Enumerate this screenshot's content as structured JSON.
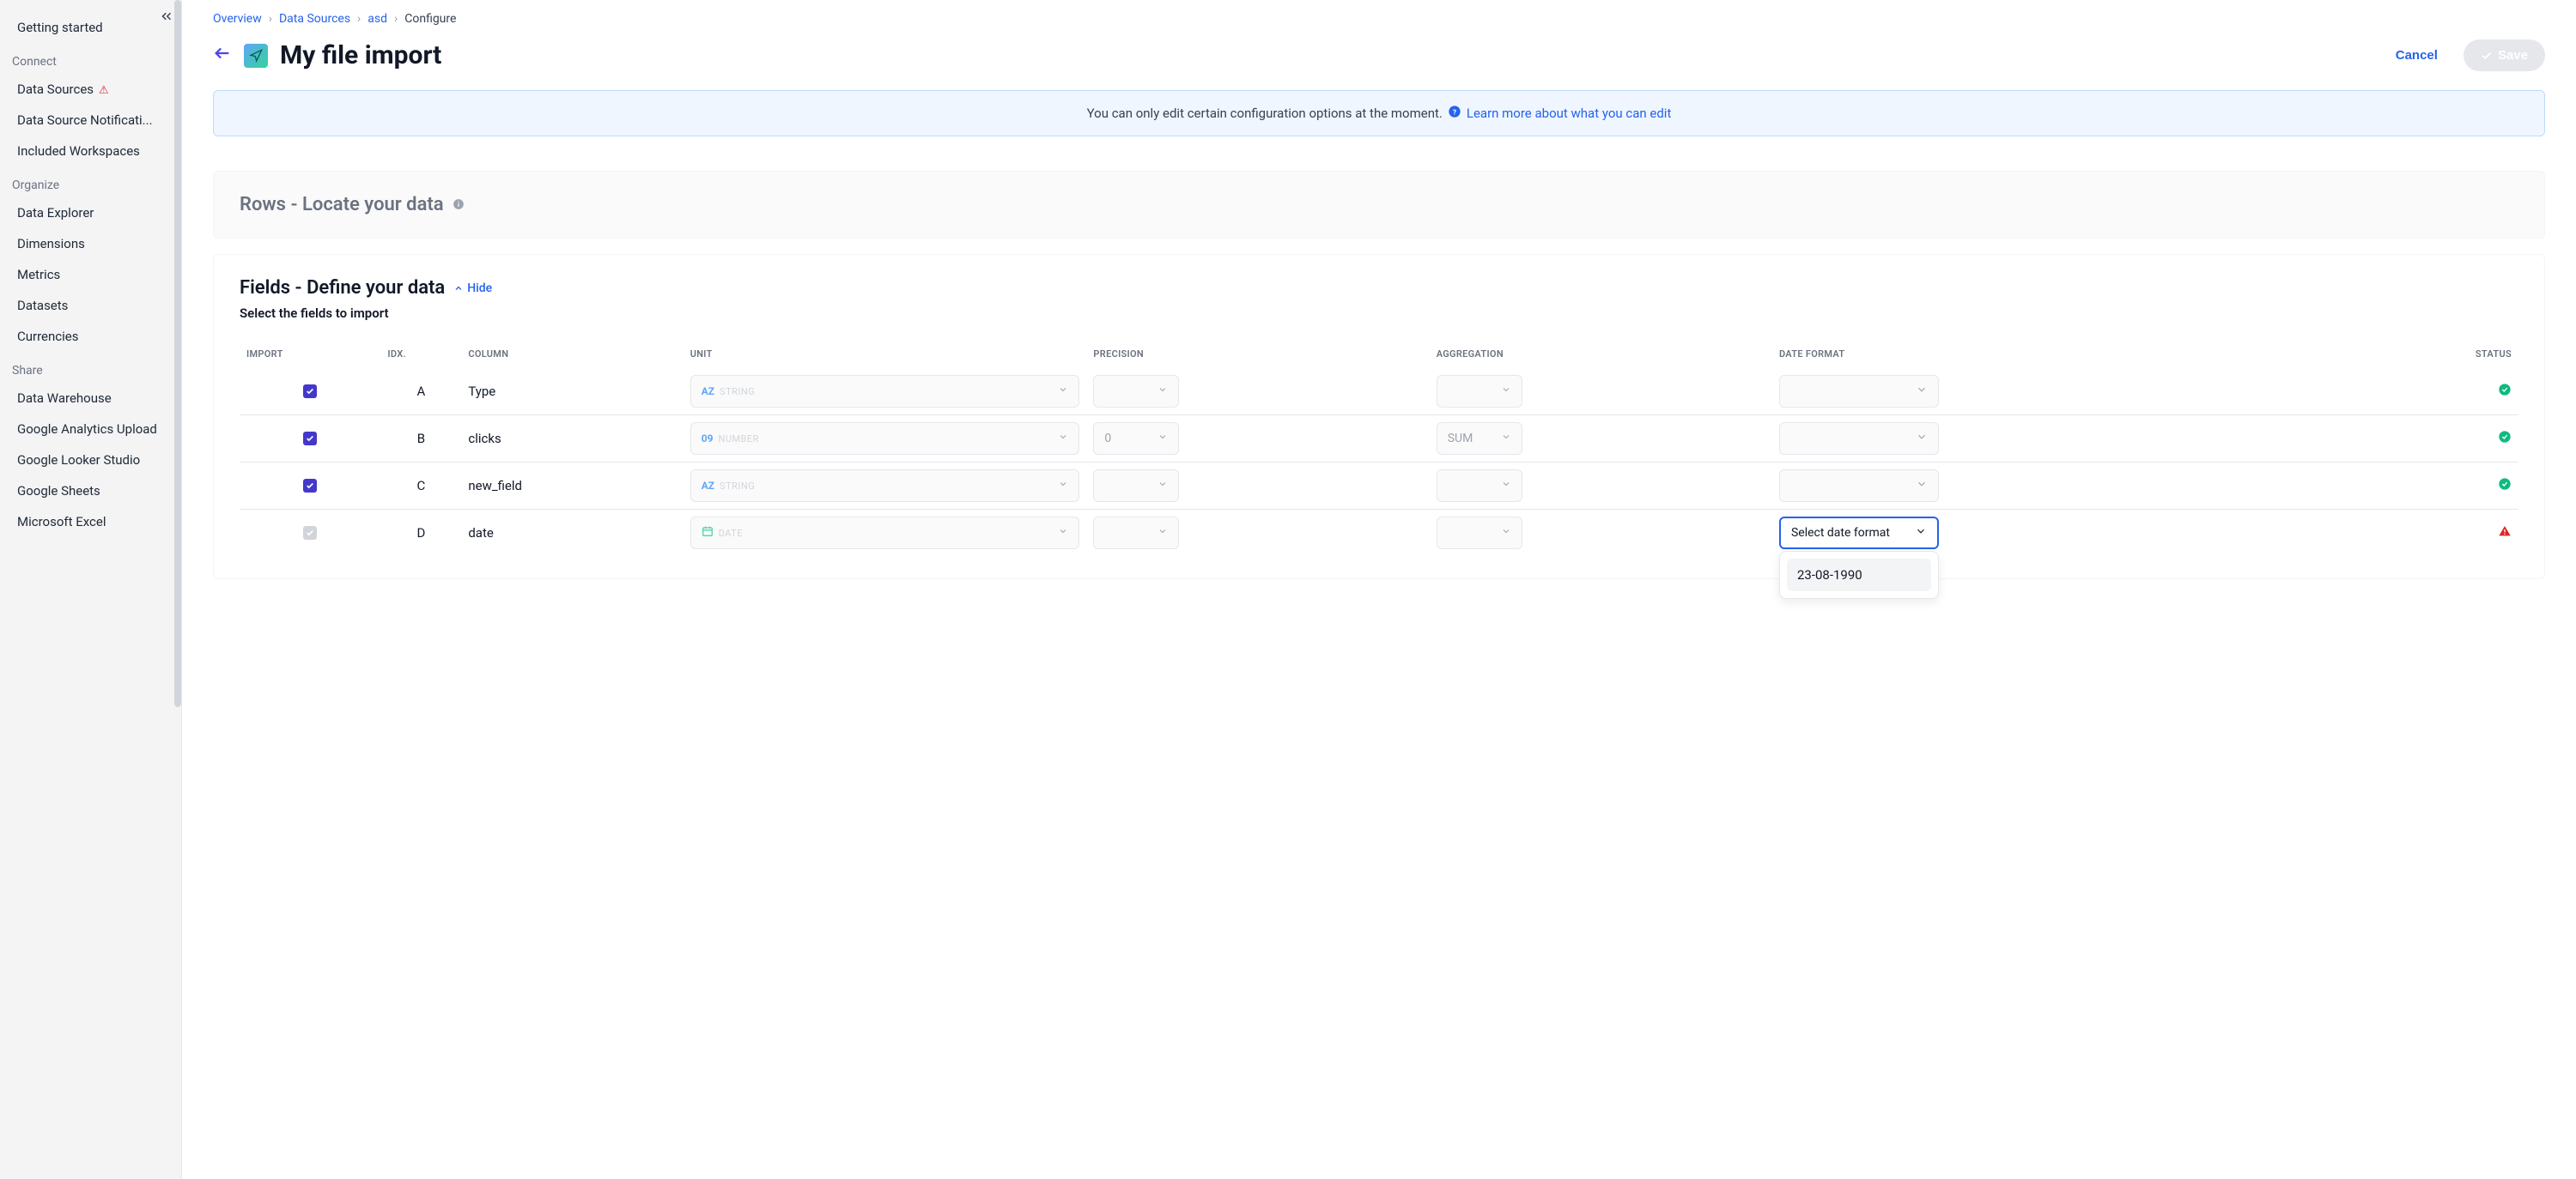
{
  "sidebar": {
    "getting_started": "Getting started",
    "section_connect": "Connect",
    "data_sources": "Data Sources",
    "data_source_notifications": "Data Source Notificati...",
    "included_workspaces": "Included Workspaces",
    "section_organize": "Organize",
    "data_explorer": "Data Explorer",
    "dimensions": "Dimensions",
    "metrics": "Metrics",
    "datasets": "Datasets",
    "currencies": "Currencies",
    "section_share": "Share",
    "data_warehouse": "Data Warehouse",
    "google_analytics_upload": "Google Analytics Upload",
    "google_looker_studio": "Google Looker Studio",
    "google_sheets": "Google Sheets",
    "microsoft_excel": "Microsoft Excel"
  },
  "breadcrumbs": {
    "overview": "Overview",
    "data_sources": "Data Sources",
    "asd": "asd",
    "configure": "Configure"
  },
  "header": {
    "title": "My file import",
    "cancel": "Cancel",
    "save": "Save"
  },
  "banner": {
    "text": "You can only edit certain configuration options at the moment.",
    "learn_link": "Learn more about what you can edit"
  },
  "rows_section": {
    "title": "Rows - Locate your data"
  },
  "fields_section": {
    "title": "Fields - Define your data",
    "hide_label": "Hide",
    "subtitle": "Select the fields to import",
    "columns": {
      "import": "IMPORT",
      "idx": "IDX.",
      "column": "COLUMN",
      "unit": "UNIT",
      "precision": "PRECISION",
      "aggregation": "AGGREGATION",
      "date_format": "DATE FORMAT",
      "status": "STATUS"
    },
    "rows": [
      {
        "idx": "A",
        "column": "Type",
        "unit_badge": "AZ",
        "unit_type": "STRING",
        "precision": "",
        "aggregation": "",
        "dateformat": "",
        "status": "ok",
        "checked": true
      },
      {
        "idx": "B",
        "column": "clicks",
        "unit_badge": "09",
        "unit_type": "NUMBER",
        "precision": "0",
        "aggregation": "SUM",
        "dateformat": "",
        "status": "ok",
        "checked": true
      },
      {
        "idx": "C",
        "column": "new_field",
        "unit_badge": "AZ",
        "unit_type": "STRING",
        "precision": "",
        "aggregation": "",
        "dateformat": "",
        "status": "ok",
        "checked": true
      },
      {
        "idx": "D",
        "column": "date",
        "unit_badge": "CAL",
        "unit_type": "DATE",
        "precision": "",
        "aggregation": "",
        "dateformat": "Select date format",
        "status": "err",
        "checked": false
      }
    ],
    "dropdown_option": "23-08-1990"
  }
}
